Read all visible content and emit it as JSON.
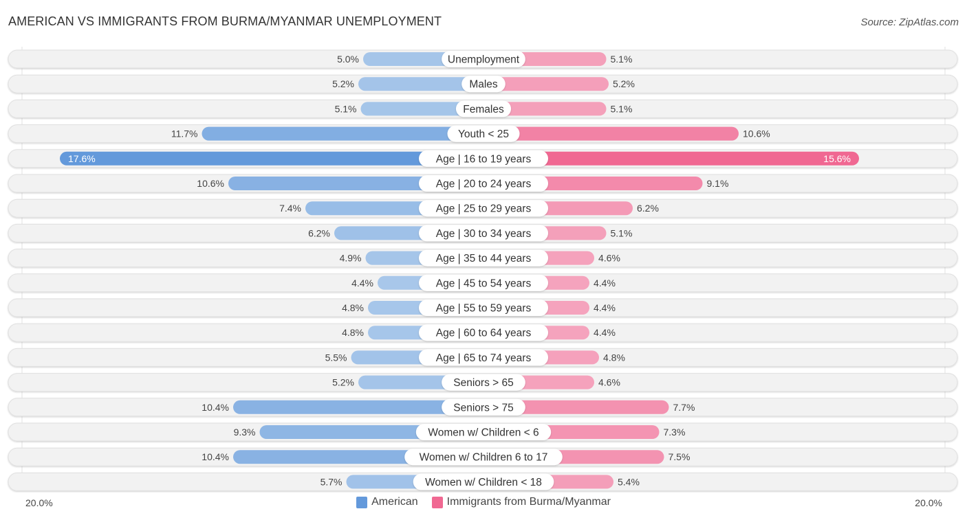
{
  "header": {
    "title": "AMERICAN VS IMMIGRANTS FROM BURMA/MYANMAR UNEMPLOYMENT",
    "source": "Source: ZipAtlas.com"
  },
  "colors": {
    "american_strong": "#6399db",
    "american_light": "#a8c7ea",
    "immigrant_strong": "#f06892",
    "immigrant_light": "#f5a6bf",
    "row_bg": "#f2f2f2"
  },
  "chart_data": {
    "type": "bar",
    "orientation": "horizontal-diverging",
    "title": "AMERICAN VS IMMIGRANTS FROM BURMA/MYANMAR UNEMPLOYMENT",
    "xlabel": "",
    "ylabel": "",
    "xlim": [
      -20,
      20
    ],
    "axis_min_label": "20.0%",
    "axis_max_label": "20.0%",
    "legend_position": "bottom-center",
    "categories": [
      "Unemployment",
      "Males",
      "Females",
      "Youth < 25",
      "Age | 16 to 19 years",
      "Age | 20 to 24 years",
      "Age | 25 to 29 years",
      "Age | 30 to 34 years",
      "Age | 35 to 44 years",
      "Age | 45 to 54 years",
      "Age | 55 to 59 years",
      "Age | 60 to 64 years",
      "Age | 65 to 74 years",
      "Seniors > 65",
      "Seniors > 75",
      "Women w/ Children < 6",
      "Women w/ Children 6 to 17",
      "Women w/ Children < 18"
    ],
    "series": [
      {
        "name": "American",
        "side": "left",
        "values": [
          5.0,
          5.2,
          5.1,
          11.7,
          17.6,
          10.6,
          7.4,
          6.2,
          4.9,
          4.4,
          4.8,
          4.8,
          5.5,
          5.2,
          10.4,
          9.3,
          10.4,
          5.7
        ],
        "labels": [
          "5.0%",
          "5.2%",
          "5.1%",
          "11.7%",
          "17.6%",
          "10.6%",
          "7.4%",
          "6.2%",
          "4.9%",
          "4.4%",
          "4.8%",
          "4.8%",
          "5.5%",
          "5.2%",
          "10.4%",
          "9.3%",
          "10.4%",
          "5.7%"
        ]
      },
      {
        "name": "Immigrants from Burma/Myanmar",
        "side": "right",
        "values": [
          5.1,
          5.2,
          5.1,
          10.6,
          15.6,
          9.1,
          6.2,
          5.1,
          4.6,
          4.4,
          4.4,
          4.4,
          4.8,
          4.6,
          7.7,
          7.3,
          7.5,
          5.4
        ],
        "labels": [
          "5.1%",
          "5.2%",
          "5.1%",
          "10.6%",
          "15.6%",
          "9.1%",
          "6.2%",
          "5.1%",
          "4.6%",
          "4.4%",
          "4.4%",
          "4.4%",
          "4.8%",
          "4.6%",
          "7.7%",
          "7.3%",
          "7.5%",
          "5.4%"
        ]
      }
    ]
  },
  "legend": {
    "items": [
      {
        "label": "American",
        "color": "#6399db"
      },
      {
        "label": "Immigrants from Burma/Myanmar",
        "color": "#f06892"
      }
    ]
  }
}
